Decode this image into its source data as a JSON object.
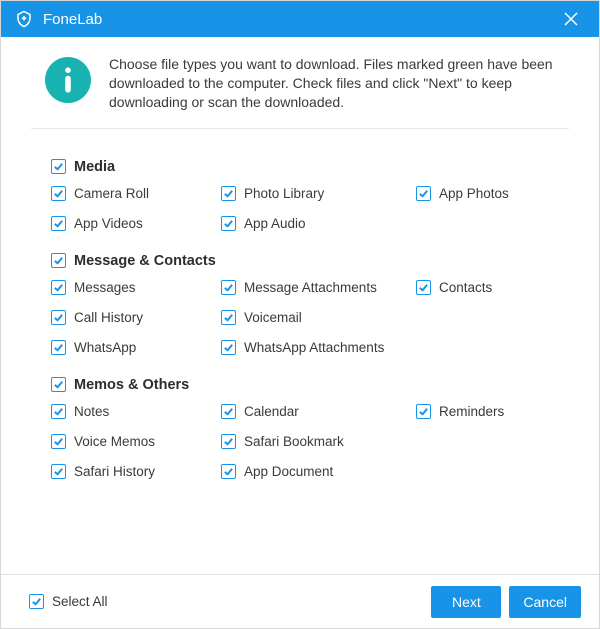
{
  "app_name": "FoneLab",
  "intro_text": "Choose file types you want to download. Files marked green have been downloaded to the computer. Check files and click \"Next\" to keep downloading or scan the downloaded.",
  "groups": [
    {
      "title": "Media",
      "items": [
        {
          "label": "Camera Roll",
          "checked": true
        },
        {
          "label": "Photo Library",
          "checked": true
        },
        {
          "label": "App Photos",
          "checked": true
        },
        {
          "label": "App Videos",
          "checked": true
        },
        {
          "label": "App Audio",
          "checked": true
        }
      ]
    },
    {
      "title": "Message & Contacts",
      "items": [
        {
          "label": "Messages",
          "checked": true
        },
        {
          "label": "Message Attachments",
          "checked": true
        },
        {
          "label": "Contacts",
          "checked": true
        },
        {
          "label": "Call History",
          "checked": true
        },
        {
          "label": "Voicemail",
          "checked": true
        },
        {
          "label": "",
          "checked": false,
          "empty": true
        },
        {
          "label": "WhatsApp",
          "checked": true
        },
        {
          "label": "WhatsApp Attachments",
          "checked": true
        }
      ]
    },
    {
      "title": "Memos & Others",
      "items": [
        {
          "label": "Notes",
          "checked": true
        },
        {
          "label": "Calendar",
          "checked": true
        },
        {
          "label": "Reminders",
          "checked": true
        },
        {
          "label": "Voice Memos",
          "checked": true
        },
        {
          "label": "Safari Bookmark",
          "checked": true
        },
        {
          "label": "",
          "checked": false,
          "empty": true
        },
        {
          "label": "Safari History",
          "checked": true
        },
        {
          "label": "App Document",
          "checked": true
        }
      ]
    }
  ],
  "select_all": {
    "label": "Select All",
    "checked": true
  },
  "buttons": {
    "next": "Next",
    "cancel": "Cancel"
  }
}
